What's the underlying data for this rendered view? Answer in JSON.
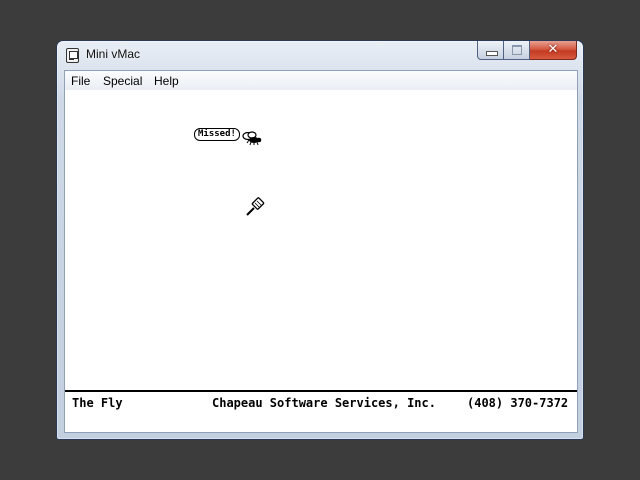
{
  "window": {
    "title": "Mini vMac"
  },
  "menu": {
    "items": [
      {
        "label": "File"
      },
      {
        "label": "Special"
      },
      {
        "label": "Help"
      }
    ]
  },
  "game": {
    "speech_bubble": "Missed!",
    "icons": [
      "fly-icon",
      "fly-swatter-icon"
    ]
  },
  "status": {
    "left": "The Fly",
    "center": "Chapeau Software Services, Inc.",
    "right": "(408) 370-7372"
  },
  "colors": {
    "desktop": "#3c3c3c",
    "close_button": "#c23b22",
    "screen_background": "#ffffff"
  }
}
